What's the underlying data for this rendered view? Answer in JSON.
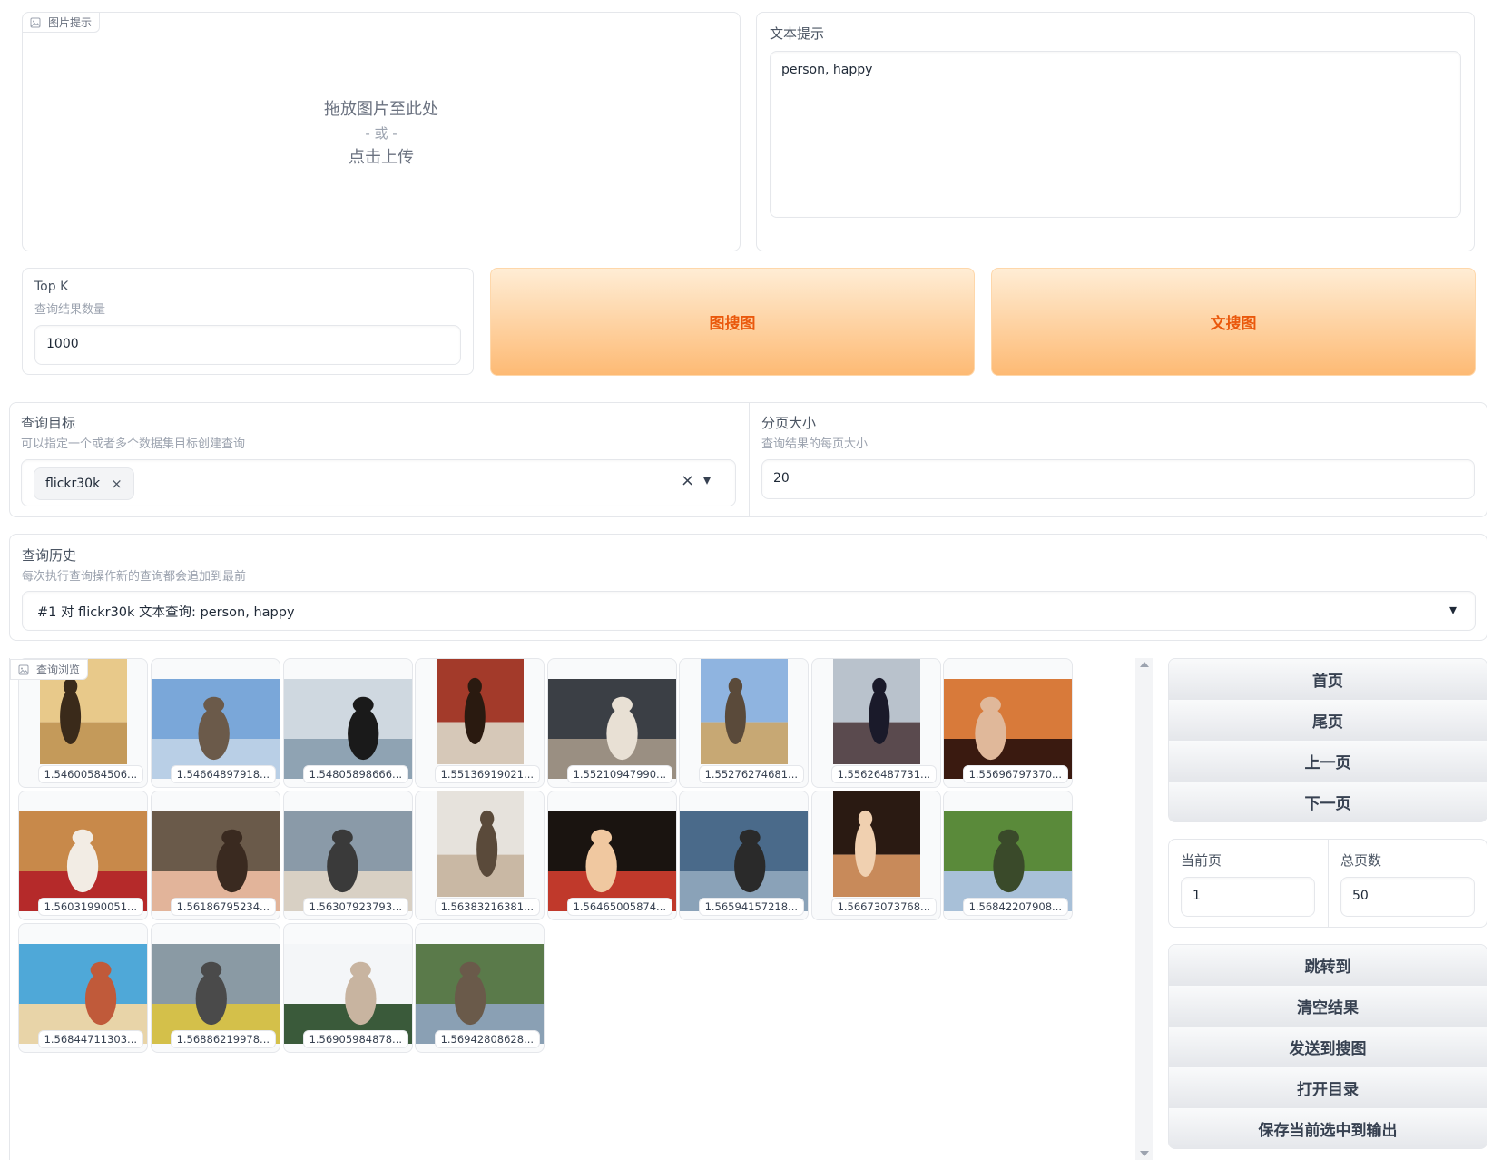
{
  "image_prompt": {
    "tag_label": "图片提示",
    "drop_text": "拖放图片至此处",
    "or_text": "- 或 -",
    "upload_text": "点击上传"
  },
  "text_prompt": {
    "label": "文本提示",
    "value": "person, happy"
  },
  "topk": {
    "label": "Top K",
    "info": "查询结果数量",
    "value": "1000"
  },
  "buttons": {
    "image_search": "图搜图",
    "text_search": "文搜图"
  },
  "query_target": {
    "label": "查询目标",
    "info": "可以指定一个或者多个数据集目标创建查询",
    "chip": "flickr30k",
    "chip_remove": "×",
    "clear": "×",
    "dropdown": "▾"
  },
  "page_size": {
    "label": "分页大小",
    "info": "查询结果的每页大小",
    "value": "20"
  },
  "history": {
    "label": "查询历史",
    "info": "每次执行查询操作新的查询都会追加到最前",
    "value": "#1 对 flickr30k 文本查询: person, happy",
    "dropdown": "▾"
  },
  "gallery": {
    "tag_label": "查询浏览",
    "items": [
      {
        "caption": "1.54600584506...",
        "icon": "boy-yellow-shirt-photo"
      },
      {
        "caption": "1.54664897918...",
        "icon": "group-jumping-photo"
      },
      {
        "caption": "1.54805898666...",
        "icon": "man-on-beach-photo"
      },
      {
        "caption": "1.55136919021...",
        "icon": "man-red-jacket-photo"
      },
      {
        "caption": "1.55210947990...",
        "icon": "people-laughing-photo"
      },
      {
        "caption": "1.55276274681...",
        "icon": "person-jumping-photo"
      },
      {
        "caption": "1.55626487731...",
        "icon": "man-jumping-lake-photo"
      },
      {
        "caption": "1.55696797370...",
        "icon": "two-women-smiling-photo"
      },
      {
        "caption": "1.56031990051...",
        "icon": "couple-on-floor-photo"
      },
      {
        "caption": "1.56186795234...",
        "icon": "woman-smiling-photo"
      },
      {
        "caption": "1.56307923793...",
        "icon": "women-sitting-photo"
      },
      {
        "caption": "1.56383216381...",
        "icon": "toddler-photo"
      },
      {
        "caption": "1.56465005874...",
        "icon": "child-smiling-photo"
      },
      {
        "caption": "1.56594157218...",
        "icon": "beach-jumpers-photo"
      },
      {
        "caption": "1.56673073768...",
        "icon": "man-bar-photo"
      },
      {
        "caption": "1.56842207908...",
        "icon": "park-jumper-photo"
      },
      {
        "caption": "1.56844711303...",
        "icon": "beach-group-photo"
      },
      {
        "caption": "1.56886219978...",
        "icon": "fountain-jumper-photo"
      },
      {
        "caption": "1.56905984878...",
        "icon": "beach-runner-photo"
      },
      {
        "caption": "1.56942808628...",
        "icon": "river-jumper-photo"
      }
    ]
  },
  "nav": {
    "first": "首页",
    "last": "尾页",
    "prev": "上一页",
    "next": "下一页"
  },
  "pager": {
    "current_label": "当前页",
    "current_value": "1",
    "total_label": "总页数",
    "total_value": "50"
  },
  "actions": {
    "jump": "跳转到",
    "clear": "清空结果",
    "send": "发送到搜图",
    "open_dir": "打开目录",
    "save": "保存当前选中到输出"
  }
}
